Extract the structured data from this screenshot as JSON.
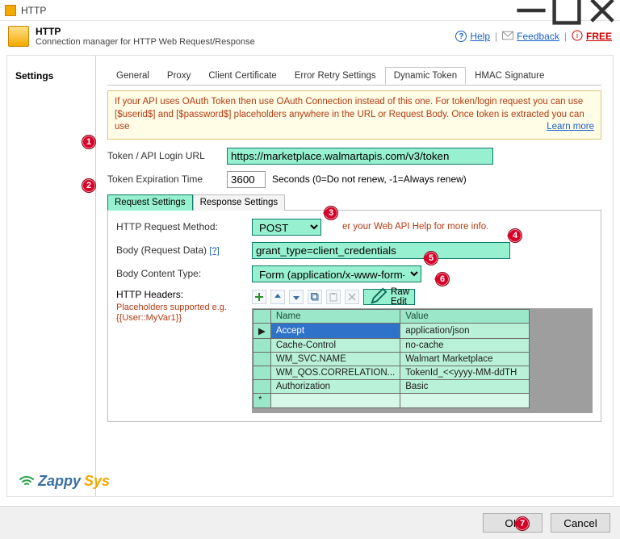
{
  "window": {
    "title": "HTTP"
  },
  "header": {
    "title": "HTTP",
    "subtitle": "Connection manager for HTTP Web Request/Response",
    "links": {
      "help": "Help",
      "feedback": "Feedback",
      "free": "FREE"
    }
  },
  "sidebar": {
    "items": [
      "Settings"
    ],
    "selected": 0
  },
  "top_tabs": {
    "items": [
      "General",
      "Proxy",
      "Client Certificate",
      "Error Retry Settings",
      "Dynamic Token",
      "HMAC Signature"
    ],
    "active": 4
  },
  "warn": {
    "text": "If your API uses OAuth Token then use OAuth Connection instead of this one. For token/login request you can use [$userid$] and [$password$] placeholders anywhere in the URL or Request Body. Once token is extracted you can use",
    "learn": "Learn more"
  },
  "form": {
    "url_label": "Token / API Login URL",
    "url_value": "https://marketplace.walmartapis.com/v3/token",
    "exp_label": "Token Expiration Time",
    "exp_value": "3600",
    "exp_suffix": "Seconds (0=Do not renew, -1=Always renew)"
  },
  "subtabs": {
    "items": [
      "Request Settings",
      "Response Settings"
    ],
    "active": 0
  },
  "request": {
    "method_label": "HTTP Request Method:",
    "method_value": "POST",
    "method_hint": "er your Web API Help for more info.",
    "body_label": "Body (Request Data)",
    "body_q": "[?]",
    "body_value": "grant_type=client_credentials",
    "ctype_label": "Body Content Type:",
    "ctype_value": "Form (application/x-www-form-urlen",
    "headers_label": "HTTP Headers:",
    "placeholder_note": "Placeholders supported e.g. {{User::MyVar1}}",
    "raw_edit": "Raw Edit",
    "columns": {
      "name": "Name",
      "value": "Value"
    },
    "rows": [
      {
        "name": "Accept",
        "value": "application/json",
        "selected": true
      },
      {
        "name": "Cache-Control",
        "value": "no-cache"
      },
      {
        "name": "WM_SVC.NAME",
        "value": "Walmart Marketplace"
      },
      {
        "name": "WM_QOS.CORRELATION...",
        "value": "TokenId_<<yyyy-MM-ddTH"
      },
      {
        "name": "Authorization",
        "value": "Basic"
      }
    ]
  },
  "logo": {
    "brand1": "Zappy",
    "brand2": "Sys"
  },
  "buttons": {
    "ok": "OK",
    "cancel": "Cancel"
  },
  "markers": {
    "1": "1",
    "2": "2",
    "3": "3",
    "4": "4",
    "5": "5",
    "6": "6",
    "7": "7"
  }
}
